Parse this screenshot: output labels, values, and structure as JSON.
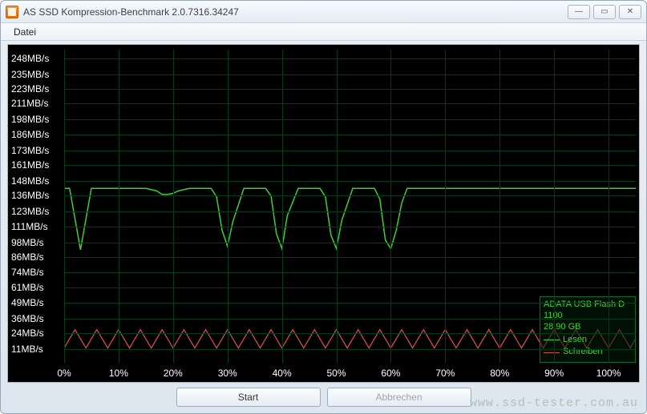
{
  "window": {
    "title": "AS SSD Kompression-Benchmark 2.0.7316.34247"
  },
  "menu": {
    "file": "Datei"
  },
  "buttons": {
    "start": "Start",
    "cancel": "Abbrechen"
  },
  "info": {
    "device": "ADATA USB Flash D",
    "firmware": "1100",
    "capacity": "28,90 GB",
    "legend_read": "Lesen",
    "legend_write": "Schreiben"
  },
  "watermark": "www.ssd-tester.com.au",
  "chart_data": {
    "type": "line",
    "title": "",
    "xlabel": "",
    "ylabel": "",
    "x_unit": "%",
    "y_unit": "MB/s",
    "xlim": [
      0,
      105
    ],
    "ylim": [
      0,
      255
    ],
    "x_ticks": [
      0,
      10,
      20,
      30,
      40,
      50,
      60,
      70,
      80,
      90,
      100
    ],
    "y_ticks": [
      11,
      24,
      36,
      49,
      61,
      74,
      86,
      98,
      111,
      123,
      136,
      148,
      161,
      173,
      186,
      198,
      211,
      223,
      235,
      248
    ],
    "y_tick_labels": [
      "11MB/s",
      "24MB/s",
      "36MB/s",
      "49MB/s",
      "61MB/s",
      "74MB/s",
      "86MB/s",
      "98MB/s",
      "111MB/s",
      "123MB/s",
      "136MB/s",
      "148MB/s",
      "161MB/s",
      "173MB/s",
      "186MB/s",
      "198MB/s",
      "211MB/s",
      "223MB/s",
      "235MB/s",
      "248MB/s"
    ],
    "x_tick_labels": [
      "0%",
      "10%",
      "20%",
      "30%",
      "40%",
      "50%",
      "60%",
      "70%",
      "80%",
      "90%",
      "100%"
    ],
    "series": [
      {
        "name": "Lesen",
        "color": "#3fcf2f",
        "x": [
          0,
          1,
          3,
          5,
          7,
          9,
          11,
          13,
          15,
          17,
          18,
          19,
          20,
          21,
          23,
          25,
          27,
          28,
          29,
          30,
          31,
          33,
          35,
          37,
          38,
          39,
          40,
          41,
          43,
          45,
          47,
          48,
          49,
          50,
          51,
          53,
          55,
          57,
          58,
          59,
          60,
          61,
          62,
          63,
          65,
          67,
          70,
          75,
          80,
          85,
          90,
          95,
          100,
          105
        ],
        "y": [
          142,
          142,
          92,
          142,
          142,
          142,
          142,
          142,
          142,
          140,
          137,
          137,
          138,
          140,
          142,
          142,
          142,
          135,
          108,
          95,
          115,
          142,
          142,
          142,
          136,
          105,
          93,
          120,
          142,
          142,
          142,
          135,
          104,
          93,
          116,
          142,
          142,
          142,
          133,
          100,
          93,
          108,
          130,
          142,
          142,
          142,
          142,
          142,
          142,
          142,
          142,
          142,
          142,
          142
        ]
      },
      {
        "name": "Schreiben",
        "color": "#d84a4a",
        "x": [
          0,
          2,
          4,
          6,
          8,
          10,
          12,
          14,
          16,
          18,
          20,
          22,
          24,
          26,
          28,
          30,
          32,
          34,
          36,
          38,
          40,
          42,
          44,
          46,
          48,
          50,
          52,
          54,
          56,
          58,
          60,
          62,
          64,
          66,
          68,
          70,
          72,
          74,
          76,
          78,
          80,
          82,
          84,
          86,
          88,
          90,
          92,
          94,
          96,
          98,
          100,
          102,
          104,
          105
        ],
        "y": [
          12,
          27,
          12,
          27,
          12,
          27,
          12,
          27,
          12,
          27,
          12,
          27,
          12,
          27,
          12,
          27,
          12,
          27,
          12,
          27,
          12,
          27,
          12,
          27,
          12,
          27,
          12,
          27,
          12,
          27,
          12,
          27,
          12,
          27,
          12,
          27,
          12,
          27,
          12,
          27,
          12,
          27,
          12,
          27,
          12,
          27,
          12,
          27,
          12,
          27,
          12,
          27,
          12,
          20
        ]
      }
    ]
  }
}
